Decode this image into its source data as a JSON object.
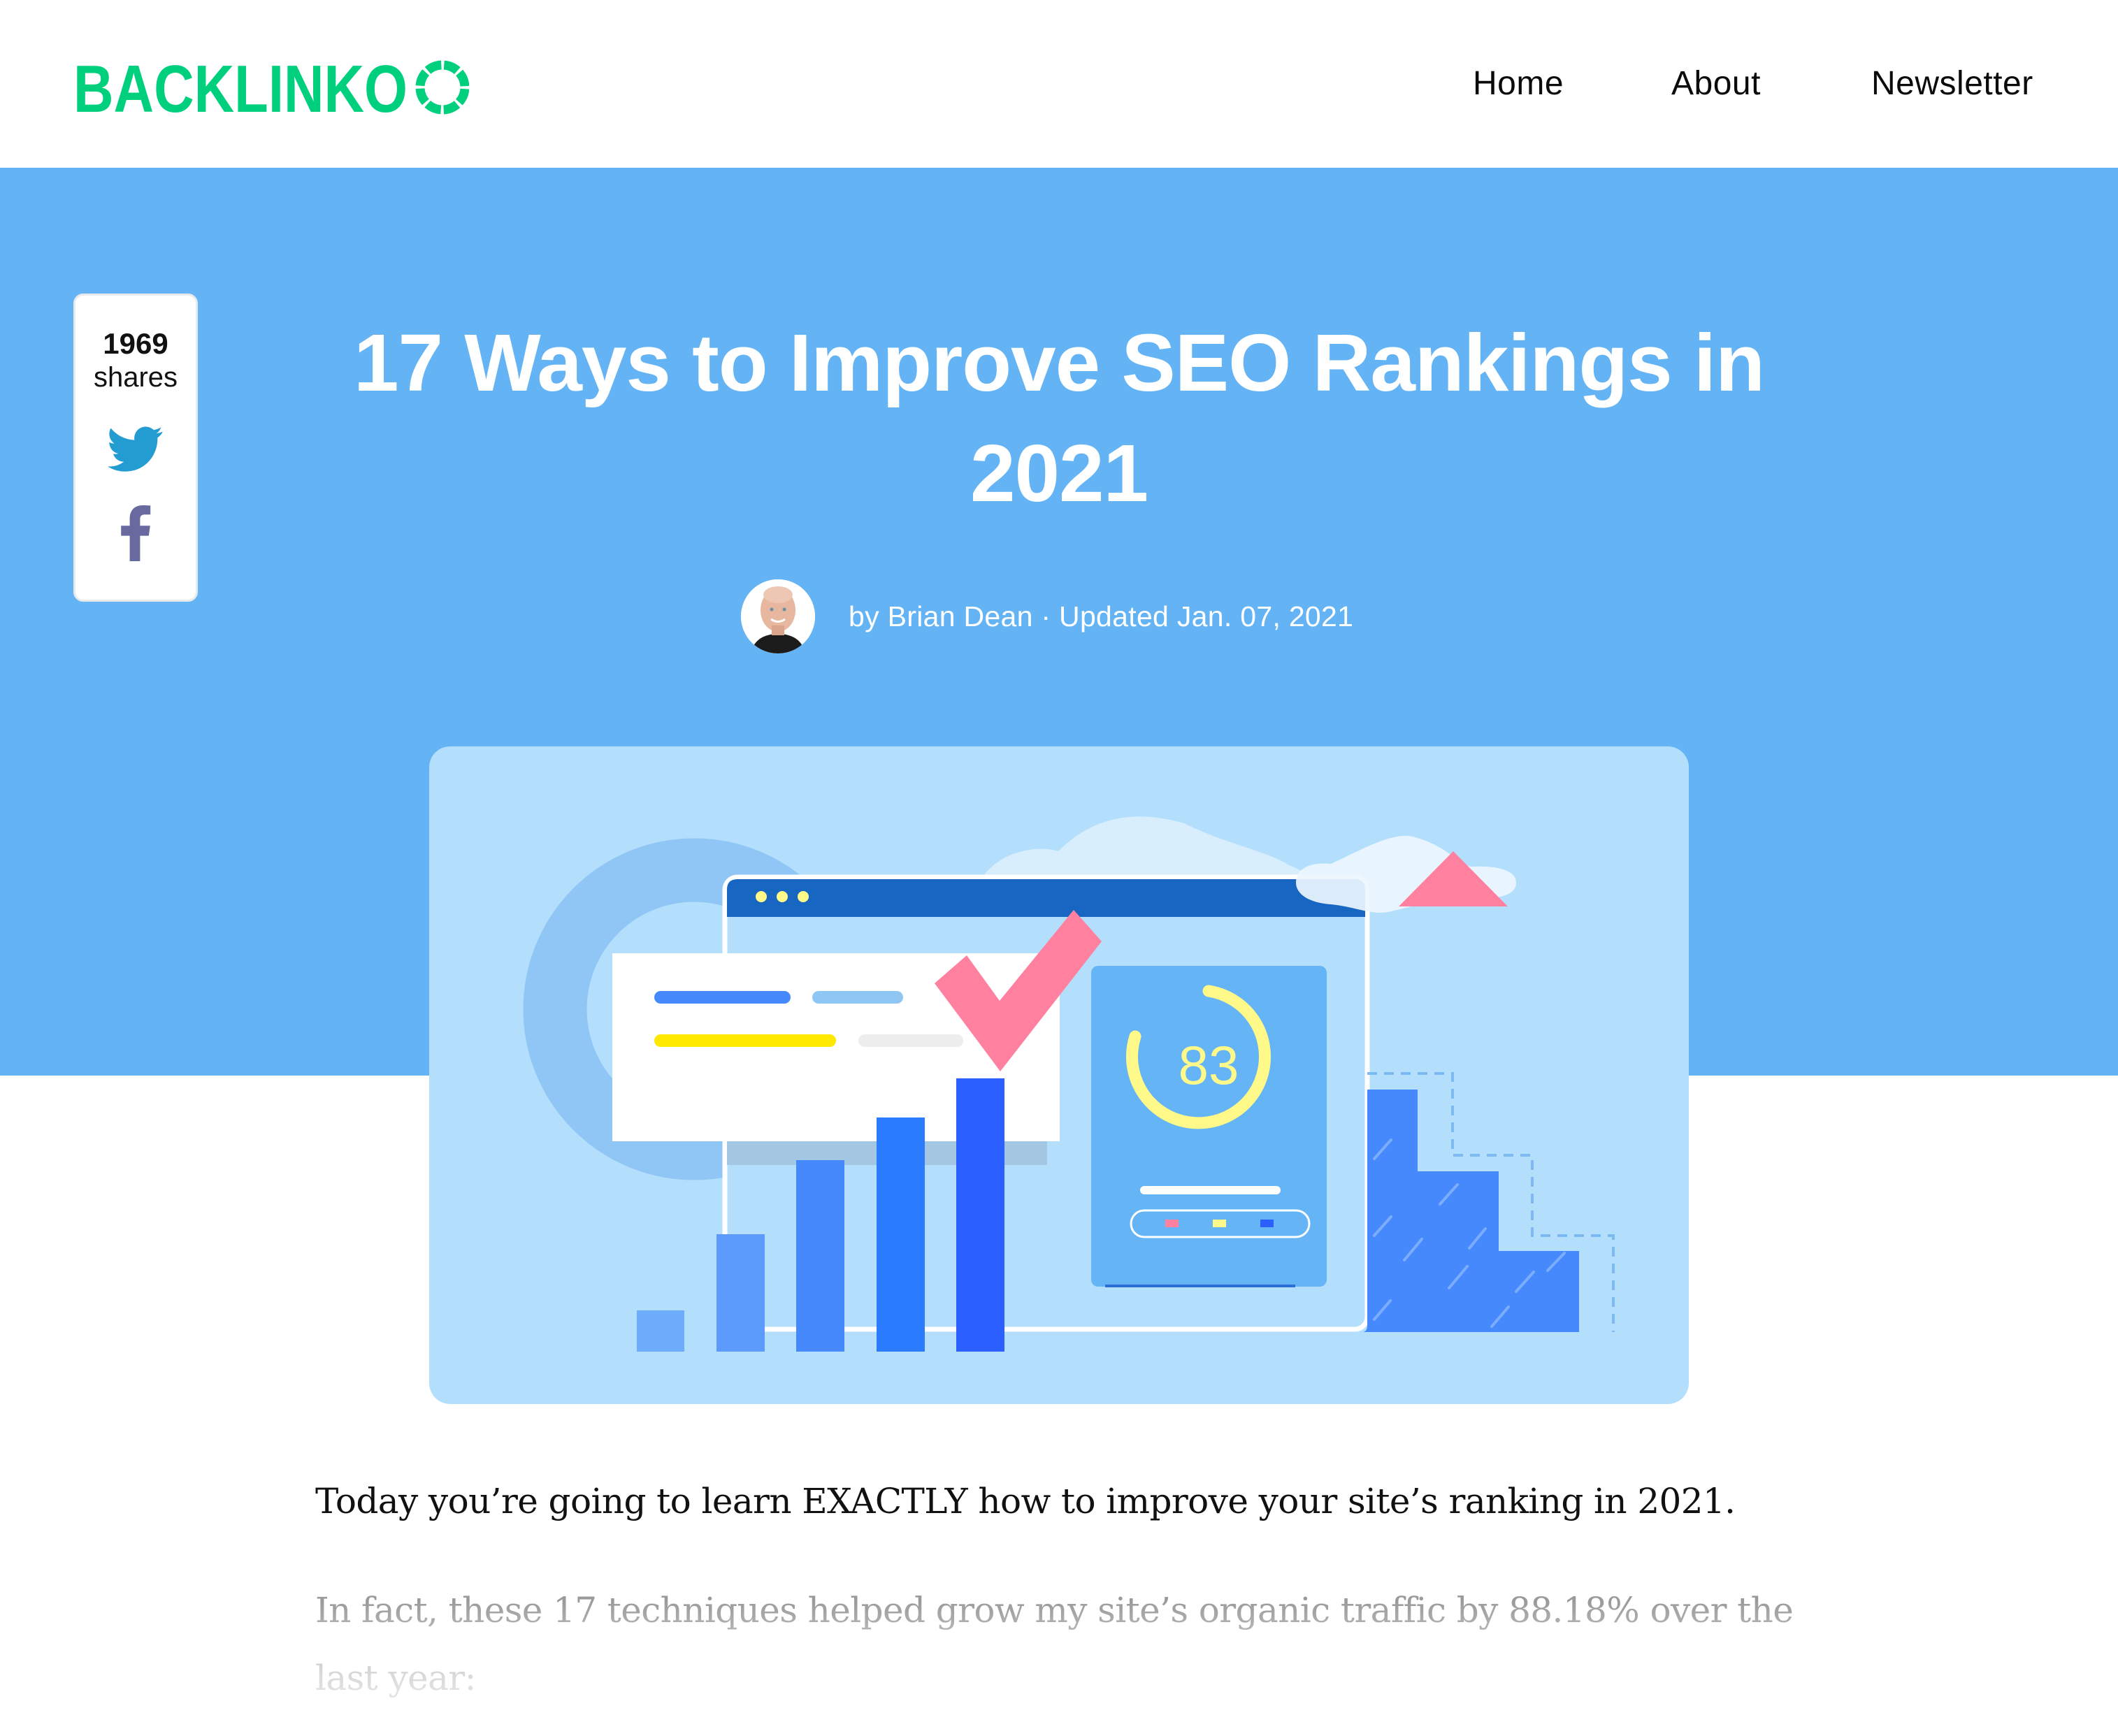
{
  "header": {
    "logo_text": "BACKLINKO",
    "brand_color": "#00D07E",
    "nav": [
      {
        "label": "Home"
      },
      {
        "label": "About"
      },
      {
        "label": "Newsletter"
      }
    ]
  },
  "hero": {
    "background_color": "#64B4F5",
    "title": "17 Ways to Improve SEO Rankings in 2021",
    "author": "Brian Dean",
    "byline": "by Brian Dean · Updated Jan. 07, 2021",
    "updated_date": "Jan. 07, 2021"
  },
  "share": {
    "count": "1969",
    "label": "shares",
    "buttons": [
      {
        "network": "twitter",
        "icon": "twitter-bird-icon",
        "color": "#229CD1"
      },
      {
        "network": "facebook",
        "icon": "facebook-f-icon",
        "color": "#67699F"
      }
    ]
  },
  "featured_image": {
    "description": "Illustration of a browser window with bar chart, checkmark and SEO score gauge",
    "score": "83",
    "score_fraction": 0.83,
    "colors": {
      "background": "#B3DFFD",
      "window_bar": "#1766C2",
      "check": "#FF809F",
      "gauge": "#FFF98A",
      "panel": "#65B4F5",
      "stairs": "#4689FD"
    }
  },
  "article": {
    "paragraphs": [
      "Today you’re going to learn EXACTLY how to improve your site’s ranking in 2021.",
      "In fact, these 17 techniques helped grow my site’s organic traffic by 88.18% over the last year:"
    ]
  }
}
